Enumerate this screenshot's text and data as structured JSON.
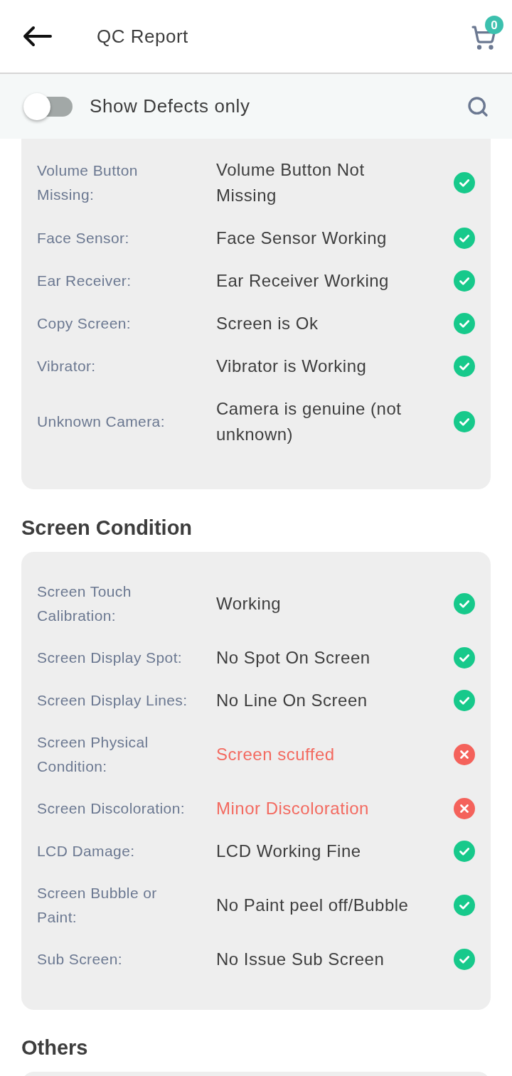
{
  "header": {
    "title": "QC Report",
    "cart_count": "0"
  },
  "filter": {
    "label": "Show Defects only",
    "on": false
  },
  "sections": [
    {
      "rows": [
        {
          "label": "Volume Button Missing:",
          "value": "Volume Button Not Missing",
          "passed": true
        },
        {
          "label": "Face Sensor:",
          "value": "Face Sensor Working",
          "passed": true
        },
        {
          "label": "Ear Receiver:",
          "value": "Ear Receiver Working",
          "passed": true
        },
        {
          "label": "Copy Screen:",
          "value": "Screen is Ok",
          "passed": true
        },
        {
          "label": "Vibrator:",
          "value": "Vibrator is Working",
          "passed": true
        },
        {
          "label": "Unknown Camera:",
          "value": "Camera is genuine (not unknown)",
          "passed": true
        }
      ]
    },
    {
      "title": "Screen Condition",
      "rows": [
        {
          "label": "Screen Touch Calibration:",
          "value": "Working",
          "passed": true
        },
        {
          "label": "Screen Display Spot:",
          "value": "No Spot On Screen",
          "passed": true
        },
        {
          "label": "Screen Display Lines:",
          "value": "No Line On Screen",
          "passed": true
        },
        {
          "label": "Screen Physical Condition:",
          "value": "Screen scuffed",
          "passed": false
        },
        {
          "label": "Screen Discoloration:",
          "value": "Minor Discoloration",
          "passed": false
        },
        {
          "label": "LCD Damage:",
          "value": "LCD Working Fine",
          "passed": true
        },
        {
          "label": "Screen Bubble or Paint:",
          "value": "No Paint peel off/Bubble",
          "passed": true
        },
        {
          "label": "Sub Screen:",
          "value": "No Issue Sub Screen",
          "passed": true
        }
      ]
    },
    {
      "title": "Others"
    }
  ]
}
